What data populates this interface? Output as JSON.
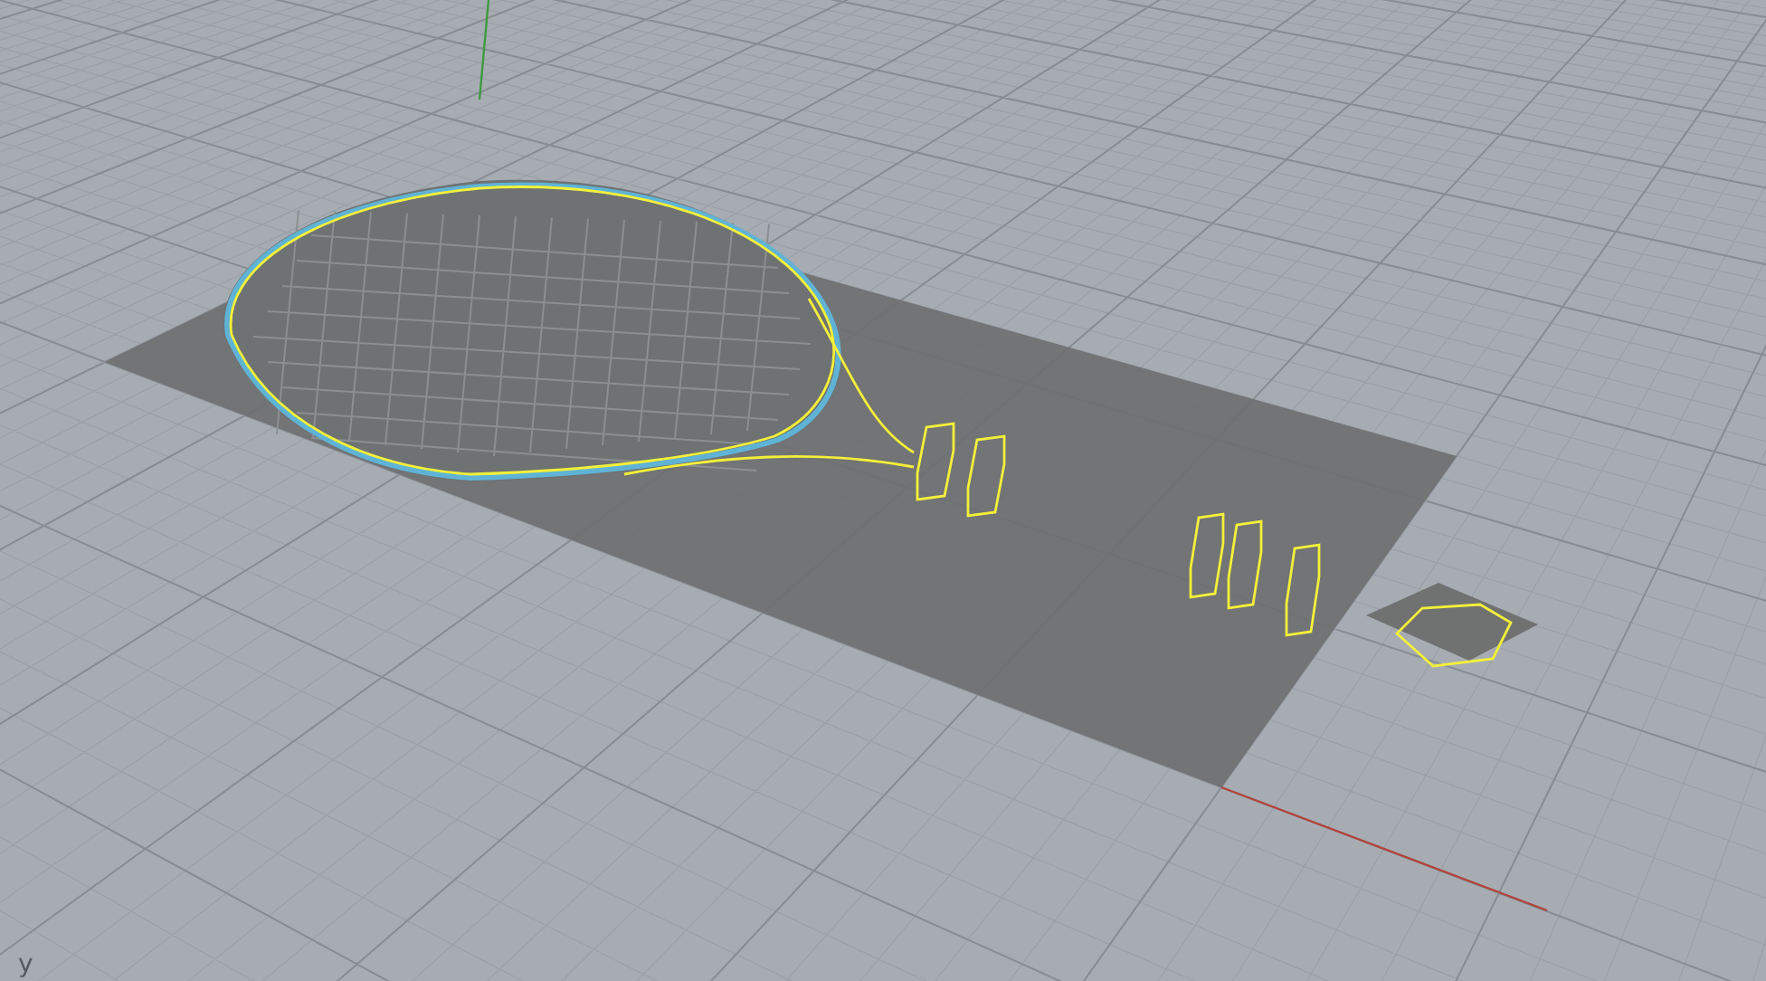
{
  "viewport": {
    "axis_labels": [
      "y"
    ]
  }
}
